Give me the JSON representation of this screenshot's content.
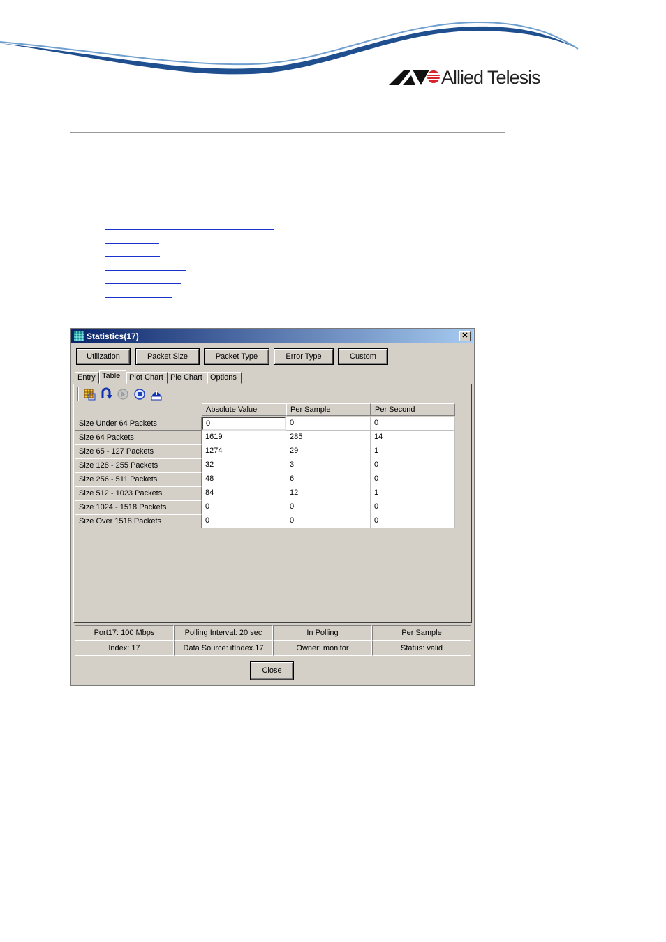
{
  "brand": {
    "name": "Allied Telesis"
  },
  "dialog": {
    "title": "Statistics(17)",
    "close_glyph": "✕",
    "top_buttons": [
      "Utilization",
      "Packet Size",
      "Packet Type",
      "Error Type",
      "Custom"
    ],
    "active_top_button": "Packet Size",
    "tabs": [
      "Entry",
      "Table",
      "Plot Chart",
      "Pie Chart",
      "Options"
    ],
    "active_tab": "Table",
    "toolbar_icons": [
      "grid-icon",
      "refresh-icon",
      "play-icon",
      "stop-icon",
      "alarm-icon"
    ],
    "table": {
      "headers": [
        "Absolute Value",
        "Per Sample",
        "Per Second"
      ],
      "rows": [
        {
          "label": "Size Under 64 Packets",
          "values": [
            "0",
            "0",
            "0"
          ]
        },
        {
          "label": "Size 64 Packets",
          "values": [
            "1619",
            "285",
            "14"
          ]
        },
        {
          "label": "Size 65 - 127 Packets",
          "values": [
            "1274",
            "29",
            "1"
          ]
        },
        {
          "label": "Size 128 - 255 Packets",
          "values": [
            "32",
            "3",
            "0"
          ]
        },
        {
          "label": "Size 256 - 511 Packets",
          "values": [
            "48",
            "6",
            "0"
          ]
        },
        {
          "label": "Size 512 - 1023 Packets",
          "values": [
            "84",
            "12",
            "1"
          ]
        },
        {
          "label": "Size 1024 - 1518 Packets",
          "values": [
            "0",
            "0",
            "0"
          ]
        },
        {
          "label": "Size Over 1518 Packets",
          "values": [
            "0",
            "0",
            "0"
          ]
        }
      ]
    },
    "status": [
      [
        "Port17: 100 Mbps",
        "Polling Interval: 20 sec",
        "In Polling",
        "Per Sample"
      ],
      [
        "Index: 17",
        "Data Source: ifIndex.17",
        "Owner: monitor",
        "Status: valid"
      ]
    ],
    "close_button": "Close"
  },
  "colors": {
    "titlebar_start": "#0a246a",
    "titlebar_end": "#a6caf0",
    "dialog_bg": "#d4d0c8",
    "logo_red": "#d8232a",
    "link_blue": "#1a33cc"
  }
}
